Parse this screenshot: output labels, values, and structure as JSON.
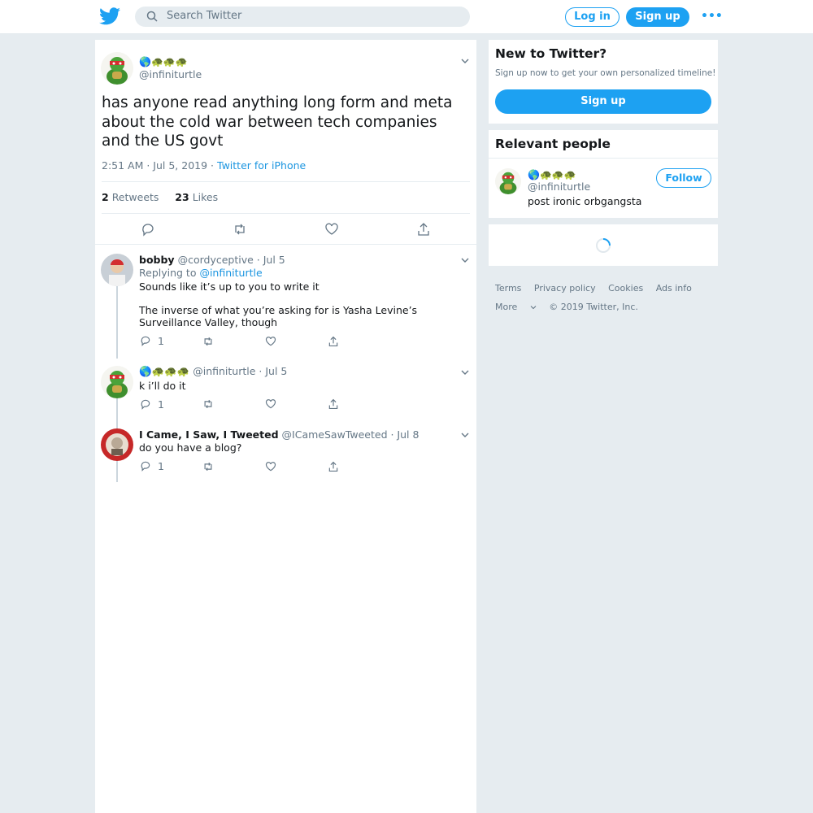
{
  "header": {
    "search_placeholder": "Search Twitter",
    "login_label": "Log in",
    "signup_label": "Sign up",
    "more_label": "•••"
  },
  "tweet": {
    "author_emoji": "🌎🐢🐢🐢",
    "author_handle": "@infiniturtle",
    "text": "has anyone read anything long form and meta about the cold war between tech companies and the US govt",
    "time": "2:51 AM · Jul 5, 2019 · ",
    "source": "Twitter for iPhone",
    "retweets": "2",
    "retweets_label": "Retweets",
    "likes": "23",
    "likes_label": "Likes"
  },
  "replies": [
    {
      "name": "bobby",
      "handle_date": " @cordyceptive · Jul 5",
      "replying_prefix": "Replying to ",
      "replying_to": "@infiniturtle",
      "text_1": "Sounds like it’s up to you to write it",
      "text_2": "The inverse of what you’re asking for is Yasha Levine’s Surveillance Valley, though",
      "reply_count": "1"
    },
    {
      "name_emoji": "🌎🐢🐢🐢",
      "handle_date": " @infiniturtle · Jul 5",
      "text_1": "k i’ll do it",
      "reply_count": "1"
    },
    {
      "name": "I Came, I Saw, I Tweeted",
      "handle_date": " @ICameSawTweeted · Jul 8",
      "text_1": "do you have a blog?",
      "reply_count": "1"
    }
  ],
  "sidebar": {
    "new_title": "New to Twitter?",
    "new_sub": "Sign up now to get your own personalized timeline!",
    "signup_label": "Sign up",
    "relevant_title": "Relevant people",
    "person_emoji": "🌎🐢🐢🐢",
    "person_handle": "@infiniturtle",
    "follow_label": "Follow",
    "person_bio": "post ironic orbgangsta"
  },
  "footer": {
    "terms": "Terms",
    "privacy": "Privacy policy",
    "cookies": "Cookies",
    "ads": "Ads info",
    "more": "More",
    "copyright": "© 2019 Twitter, Inc."
  },
  "colors": {
    "brand": "#1da1f2",
    "background": "#e6ecf0",
    "muted_text": "#657786"
  }
}
